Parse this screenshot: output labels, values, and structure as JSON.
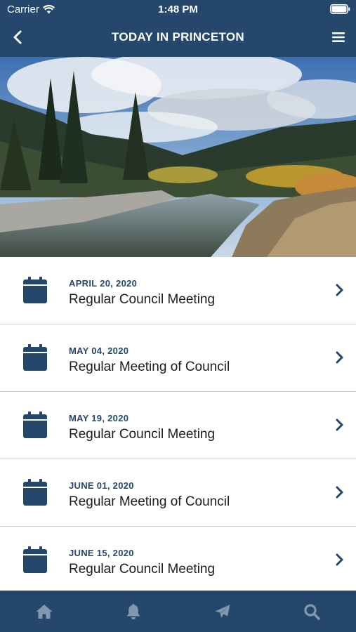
{
  "status_bar": {
    "carrier": "Carrier",
    "time": "1:48 PM",
    "wifi_icon": "wifi-icon",
    "battery_icon": "battery-icon"
  },
  "nav": {
    "title": "TODAY IN PRINCETON",
    "back_icon": "chevron-left-icon",
    "menu_icon": "hamburger-menu-icon"
  },
  "hero": {
    "description_icon": "landscape-photo"
  },
  "events": [
    {
      "date": "APRIL 20, 2020",
      "title": "Regular Council Meeting"
    },
    {
      "date": "MAY 04, 2020",
      "title": "Regular Meeting of Council"
    },
    {
      "date": "MAY 19, 2020",
      "title": "Regular Council Meeting"
    },
    {
      "date": "JUNE 01, 2020",
      "title": "Regular Meeting of Council"
    },
    {
      "date": "JUNE 15, 2020",
      "title": "Regular Council Meeting"
    }
  ],
  "tabs": [
    {
      "icon": "home-icon"
    },
    {
      "icon": "bell-icon"
    },
    {
      "icon": "send-icon"
    },
    {
      "icon": "search-icon"
    }
  ],
  "colors": {
    "primary": "#24476b",
    "tab_icon": "#8497ac",
    "divider": "#cfd3d6"
  }
}
